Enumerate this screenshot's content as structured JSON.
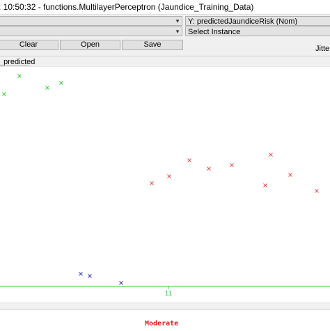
{
  "window": {
    "title": ": 10:50:32 - functions.MultilayerPerceptron (Jaundice_Training_Data)"
  },
  "controls": {
    "x_axis_select": "",
    "y_axis_select": "Y: predictedJaundiceRisk (Nom)",
    "colour_select": "",
    "instance_select": "Select Instance",
    "clear_label": "Clear",
    "open_label": "Open",
    "save_label": "Save",
    "jitter_label": "Jitte",
    "chevron_icon": "chevron-down-icon"
  },
  "plot": {
    "axis_label": "_predicted",
    "x_tick_label": "11",
    "colors": {
      "green": "#33cc33",
      "red": "#e05050",
      "blue": "#3a3aaa",
      "axis": "#33cc33"
    }
  },
  "legend": {
    "items": [
      {
        "label": "Moderate",
        "color": "#e02020"
      }
    ]
  },
  "chart_data": {
    "type": "scatter",
    "title": "",
    "xlabel": "",
    "ylabel": "_predicted",
    "x_tick_labels": [
      "11"
    ],
    "marker": "x",
    "grid": false,
    "series": [
      {
        "color": "#33cc33",
        "points": [
          [
            6,
            134
          ],
          [
            28,
            108
          ],
          [
            68,
            125
          ],
          [
            88,
            118
          ]
        ]
      },
      {
        "color": "#e05050",
        "points": [
          [
            218,
            262
          ],
          [
            243,
            252
          ],
          [
            272,
            229
          ],
          [
            300,
            241
          ],
          [
            333,
            236
          ],
          [
            381,
            265
          ],
          [
            389,
            221
          ],
          [
            417,
            250
          ],
          [
            455,
            273
          ]
        ]
      },
      {
        "color": "#3a3aaa",
        "points": [
          [
            116,
            392
          ],
          [
            129,
            395
          ],
          [
            174,
            405
          ]
        ]
      }
    ]
  }
}
